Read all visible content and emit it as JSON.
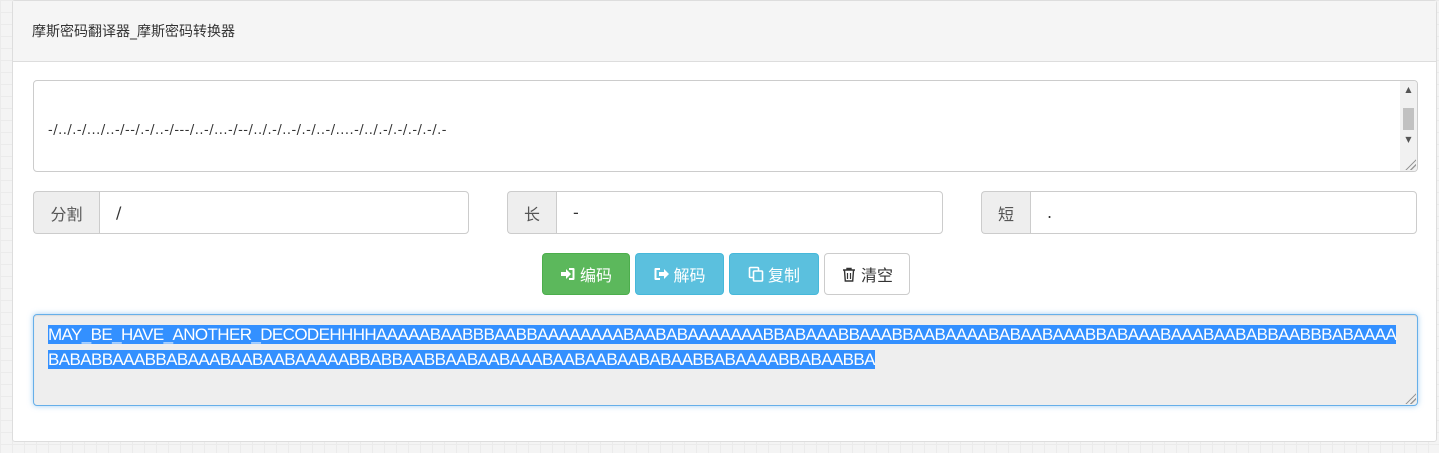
{
  "header": {
    "title": "摩斯密码翻译器_摩斯密码转换器"
  },
  "morse_input": {
    "lines": [
      "-/../.-/.../..-/--/.-/..-/---/..-/...-/--/../.-/..-/.-/..-/....-/../.-/.-/.-/.-/.-",
      "-/-../../..../..../..../..../.-/.-/.-/.-/.-/.-/-.../.-/.-/.-/-.../-.../-.../.-/.-/-.../-.../.-/.-/.-/.-/.-/.-/.-/-.../.-/.-/-.../.-/-.../.-/.-/.-/.-/.-/.-/.-/-.../-.../.-/-.../.-/.-/-.../-.../.-/.-/-.../-.../.-/.-/-.../.-/",
      "-./.-/.-/-.../.-/-.../.-/.-/.-/-.../.-/-.../-.../.-/-.../.-/.-/-.../.-/.-/-.../.-/.-/.-/.-/-.../.-/-.../.-/.-/-.../-.../-.../.-/.-/.-/.-/.-/-.../.-/-.../.-/-.../-.../.-/.-/.-/-.../.-/-.../.-/.-/-.../.-/.-/.-/-.../.-/",
      "-.../.-/.-/-.../.-/.-/.-/.-/-.../-.../.-/-.../-.../.-/.-/-.../.-/-.../.-/.-/-.../.-/.-/.-/-.../.-/.-/-.../.-/.-/-.../.-/.-/-.../.-/-.../.-/.-/-.../-.../.-/-.../.-/.-/.-/-.../-.../.-/-.../.-/.-/.-/.-/-.../.-/-.../.-/.-/-.../-.../.-"
    ]
  },
  "options": {
    "separator": {
      "label": "分割",
      "value": "/"
    },
    "long": {
      "label": "长",
      "value": "-"
    },
    "short": {
      "label": "短",
      "value": "."
    }
  },
  "buttons": {
    "encode": "编码",
    "decode": "解码",
    "copy": "复制",
    "clear": "清空"
  },
  "output": {
    "text": "MAY_BE_HAVE_ANOTHER_DECODEHHHHAAAAABAABBBAABBAAAAAAAABAABABAAAAAAABBABAAABBAAABBAABAAAABABAABAAABBABAAABAAABAABABBAABBBABAAAABABABBAAABBABAAABAABAABAAAAABBABBAABBAABAABAAABAABAABAABABAABBABAAAABBABAABBA"
  },
  "colors": {
    "success": "#5cb85c",
    "info": "#5bc0de",
    "selection": "#3390ff",
    "focus_border": "#66afe9"
  }
}
